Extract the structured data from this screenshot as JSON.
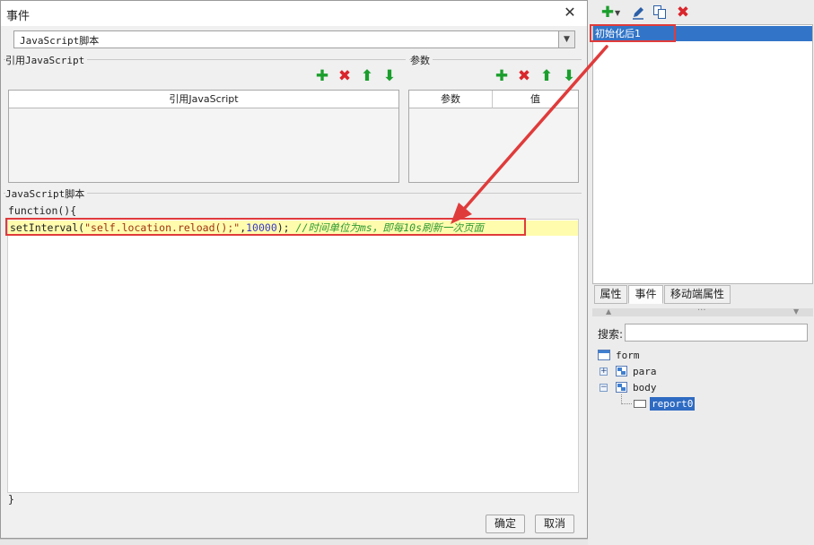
{
  "dialog": {
    "title": "事件",
    "script_type": "JavaScript脚本",
    "ref_section_label": "引用JavaScript",
    "params_section_label": "参数",
    "ref_table_header": "引用JavaScript",
    "params_headers": [
      "参数",
      "值"
    ],
    "script_section_label": "JavaScript脚本",
    "code_open": "function(){",
    "code": {
      "fn": "setInterval(",
      "arg_string": "\"self.location.reload();\"",
      "comma": ",",
      "arg_number": "10000",
      "close": "); ",
      "comment": "//时间单位为ms，即每10s刷新一次页面"
    },
    "code_close": "}",
    "ok_label": "确定",
    "cancel_label": "取消"
  },
  "right_panel": {
    "event_item": "初始化后1",
    "tabs": [
      "属性",
      "事件",
      "移动端属性"
    ],
    "active_tab": "事件",
    "search_label": "搜索:",
    "search_value": "",
    "tree": {
      "root": "form",
      "nodes": [
        {
          "label": "para",
          "expander": "+"
        },
        {
          "label": "body",
          "expander": "−",
          "children": [
            "report0"
          ]
        }
      ]
    }
  },
  "icons": {
    "add": "plus-icon",
    "delete": "x-icon",
    "up": "arrow-up-icon",
    "down": "arrow-down-icon",
    "edit": "pencil-icon",
    "copy": "copy-icon"
  },
  "colors": {
    "accent_red": "#e03b3b",
    "selection_blue": "#3275c8",
    "code_highlight": "#fffcae",
    "icon_green": "#1a9e2c"
  }
}
